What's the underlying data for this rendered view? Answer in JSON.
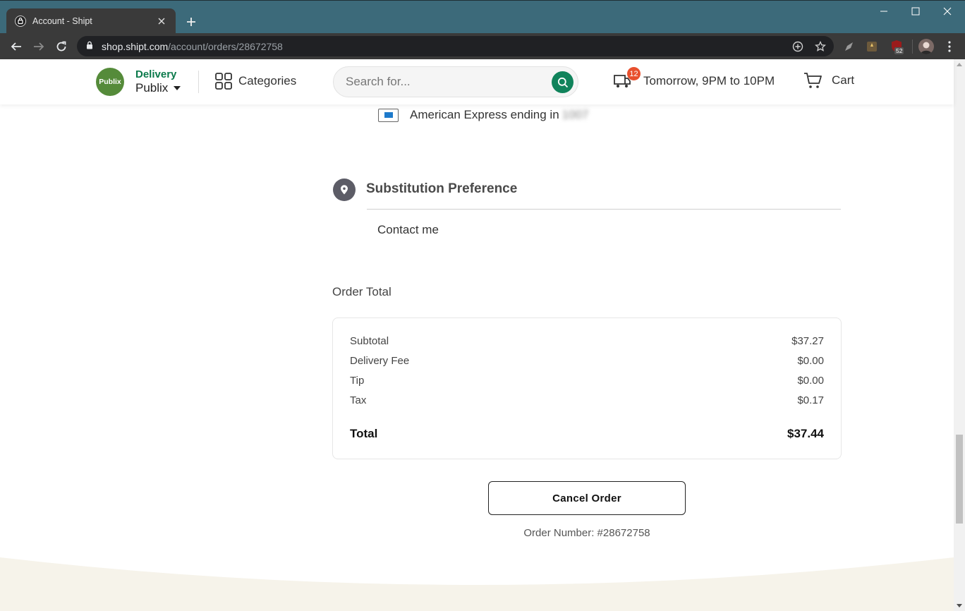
{
  "browser": {
    "tab_title": "Account - Shipt",
    "url_host": "shop.shipt.com",
    "url_path": "/account/orders/28672758",
    "extension_badge": "52"
  },
  "header": {
    "store_logo_text": "Publix",
    "delivery_label": "Delivery",
    "store_name": "Publix",
    "categories_label": "Categories",
    "search_placeholder": "Search for...",
    "delivery_window": "Tomorrow, 9PM to 10PM",
    "cart_badge_count": "12",
    "cart_label": "Cart",
    "colors": {
      "brand_green": "#10835b",
      "badge": "#e8502e",
      "store_logo": "#558b3a"
    }
  },
  "payment": {
    "method_text": "American Express ending in",
    "masked_digits": "1007"
  },
  "substitution": {
    "title": "Substitution Preference",
    "value": "Contact me"
  },
  "order_total": {
    "heading": "Order Total",
    "rows": [
      {
        "label": "Subtotal",
        "value": "$37.27"
      },
      {
        "label": "Delivery Fee",
        "value": "$0.00"
      },
      {
        "label": "Tip",
        "value": "$0.00"
      },
      {
        "label": "Tax",
        "value": "$0.17"
      }
    ],
    "total": {
      "label": "Total",
      "value": "$37.44"
    }
  },
  "actions": {
    "cancel_label": "Cancel Order"
  },
  "order_number_text": "Order Number: #28672758"
}
